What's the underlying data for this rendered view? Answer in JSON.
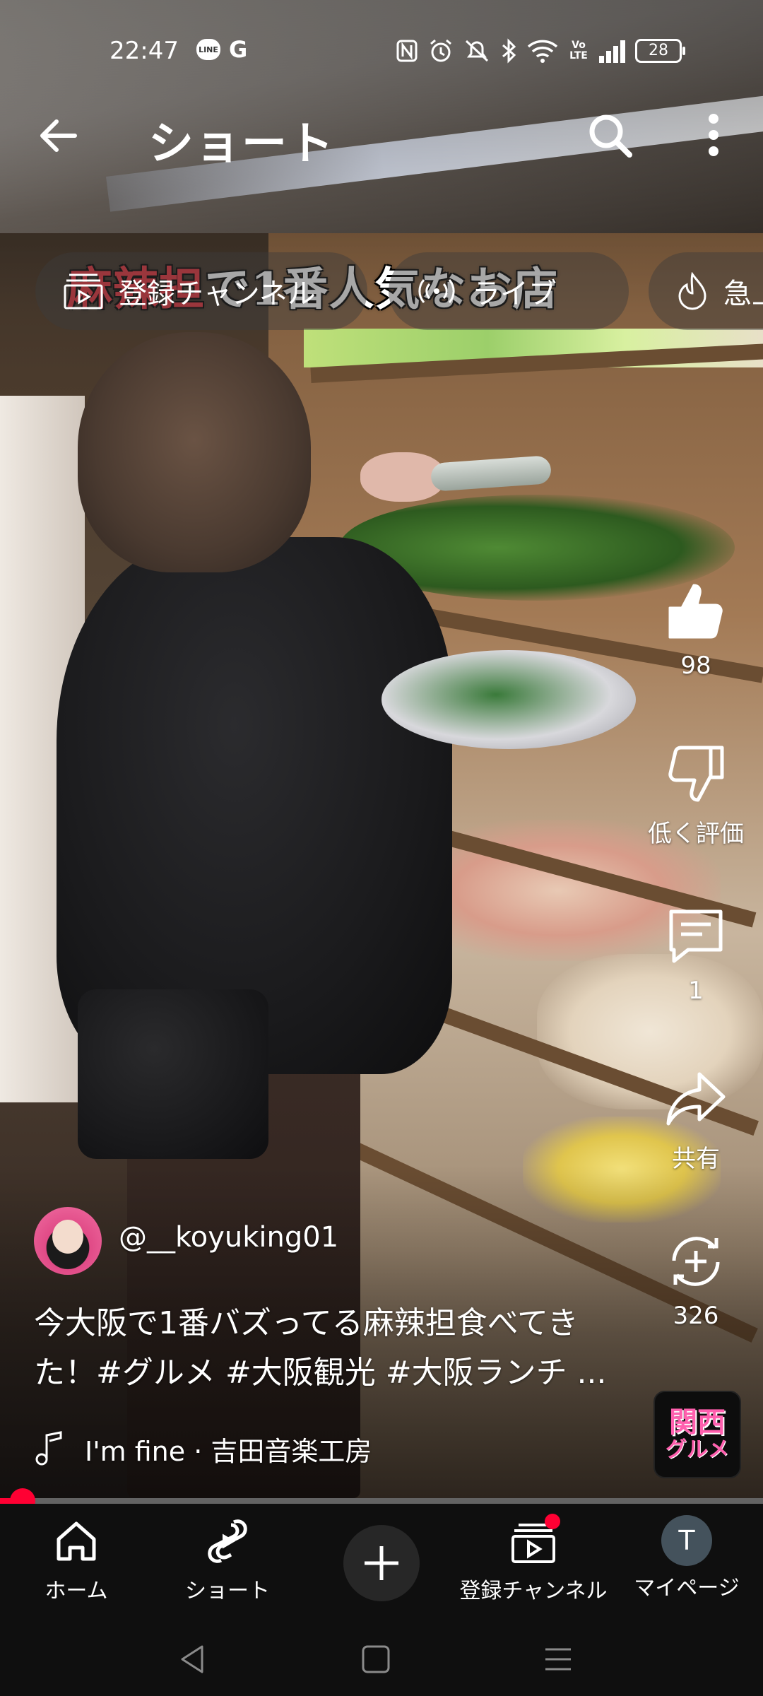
{
  "status_bar": {
    "time": "22:47",
    "left_icons": [
      "line-icon",
      "google-icon"
    ],
    "right_icons": [
      "nfc-icon",
      "alarm-icon",
      "silent-icon",
      "bluetooth-icon",
      "wifi-icon",
      "volte-icon",
      "signal-icon",
      "battery-icon"
    ],
    "line_label": "LINE",
    "g_label": "G",
    "volte_label": "Vo LTE",
    "battery": "28"
  },
  "header": {
    "title": "ショート"
  },
  "video": {
    "overlay_red": "麻辣担",
    "overlay_white": "で1番人気なお店"
  },
  "chips": [
    {
      "label": "登録チャンネル",
      "icon": "subscriptions-icon"
    },
    {
      "label": "ライブ",
      "icon": "live-icon"
    },
    {
      "label": "急上",
      "icon": "trending-icon"
    }
  ],
  "actions": {
    "like_count": "98",
    "dislike_label": "低く評価",
    "comment_count": "1",
    "share_label": "共有",
    "remix_count": "326"
  },
  "channel": {
    "name": "@__koyuking01"
  },
  "caption": {
    "line1": "今大阪で1番バズってる麻辣担食べてき",
    "line2": "た！#グルメ #大阪観光 #大阪ランチ ..."
  },
  "music": {
    "text": "I'm fine · 吉田音楽工房"
  },
  "badge": {
    "line1": "関西",
    "line2": "グルメ"
  },
  "progress": {
    "fraction": 0.03
  },
  "bottom_nav": {
    "home": "ホーム",
    "shorts": "ショート",
    "subscriptions": "登録チャンネル",
    "mypage": "マイページ",
    "avatar_initial": "T"
  },
  "colors": {
    "accent": "#ff0033",
    "nav_bg": "#0f0f0f",
    "badge_pink": "#ff5fae"
  }
}
